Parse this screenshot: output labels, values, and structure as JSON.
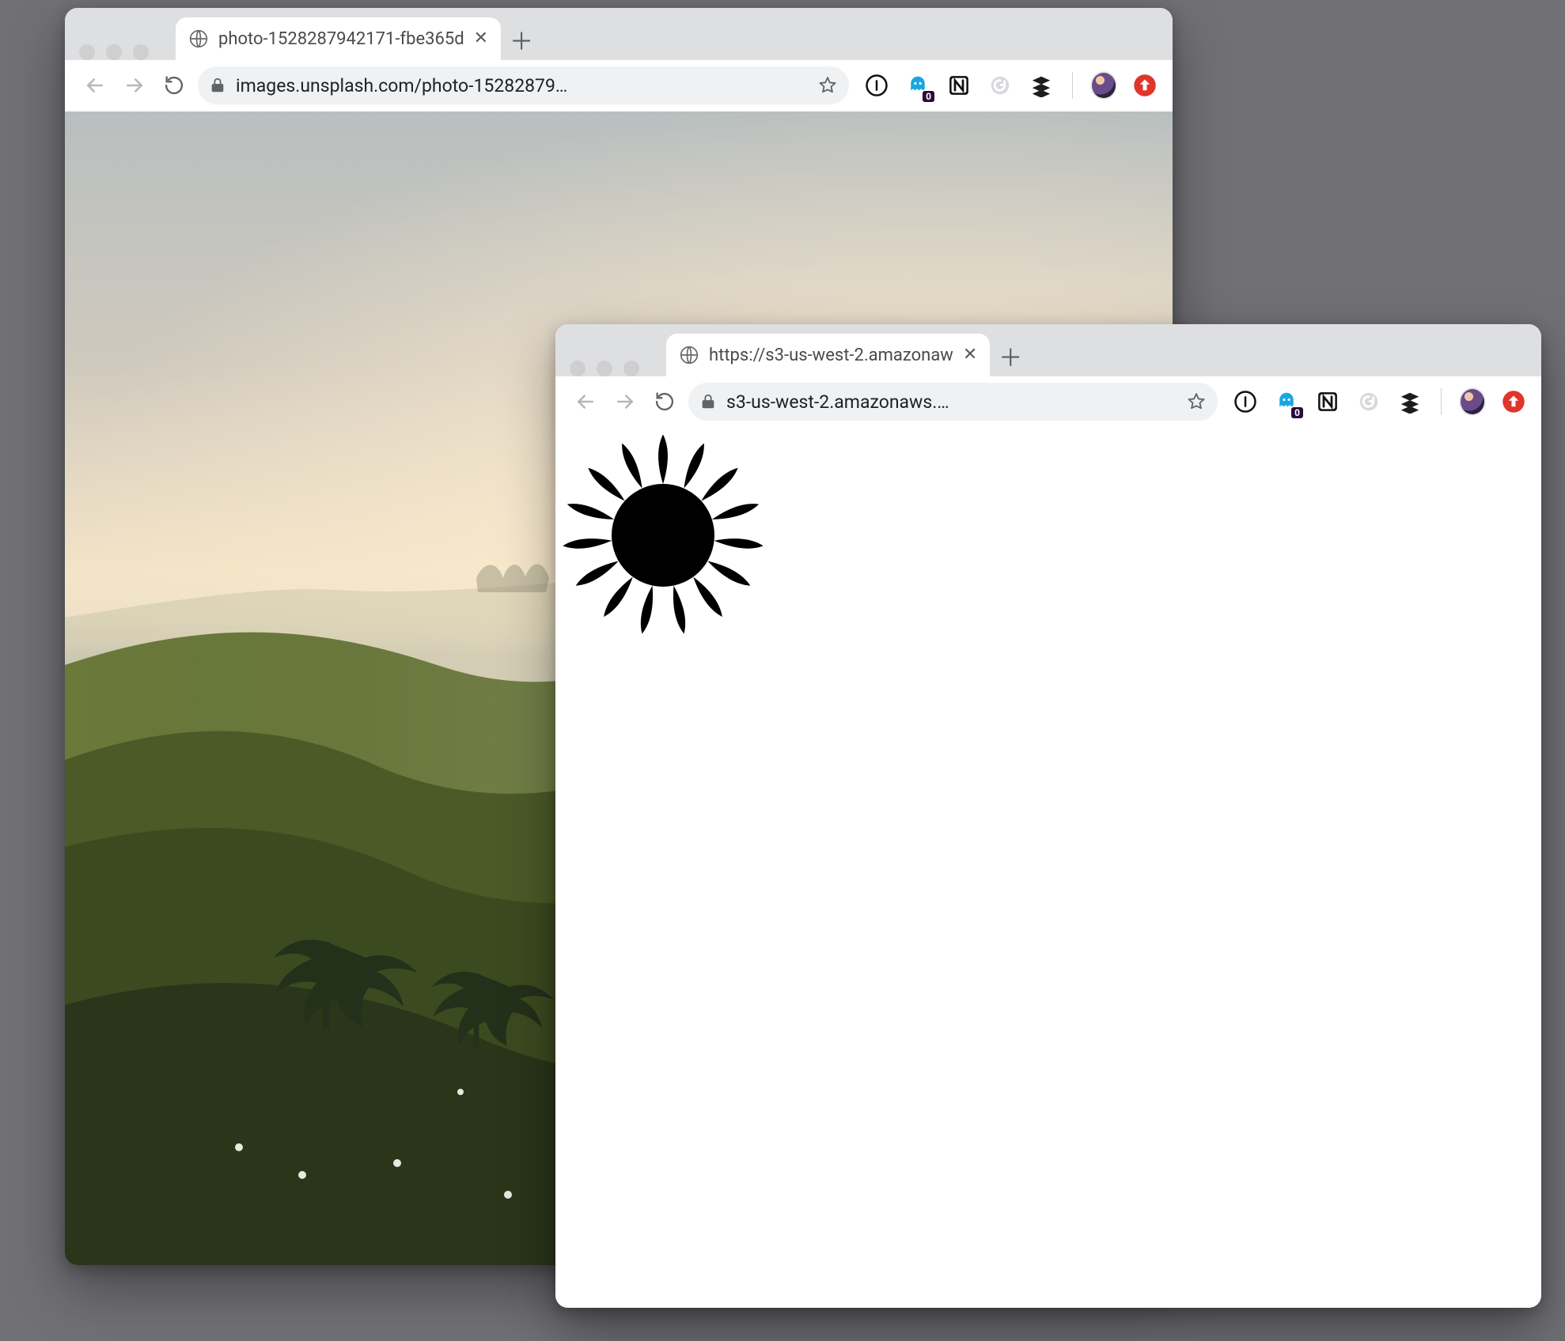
{
  "windows": [
    {
      "id": "win1",
      "tab": {
        "title": "photo-1528287942171-fbe365d",
        "favicon": "globe-icon"
      },
      "omnibox": {
        "url": "images.unsplash.com/photo-15282879…"
      },
      "extensions": {
        "ghost_badge": "0"
      },
      "content": {
        "kind": "landscape-photo"
      }
    },
    {
      "id": "win2",
      "tab": {
        "title": "https://s3-us-west-2.amazonaw",
        "favicon": "globe-icon"
      },
      "omnibox": {
        "url": "s3-us-west-2.amazonaws.…"
      },
      "extensions": {
        "ghost_badge": "0"
      },
      "content": {
        "kind": "svg-sunburst"
      }
    }
  ],
  "icons": {
    "back": "←",
    "forward": "→",
    "reload": "⟳",
    "plus": "＋",
    "close": "✕"
  }
}
